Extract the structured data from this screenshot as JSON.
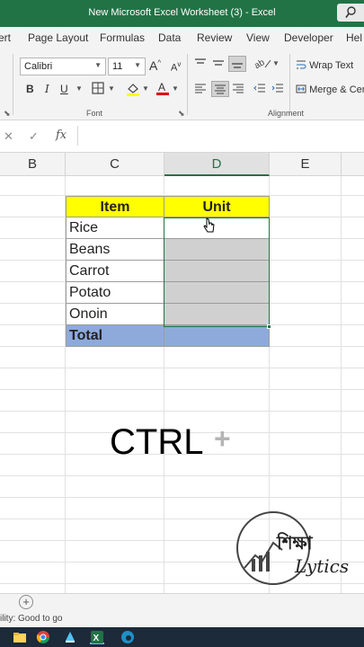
{
  "window": {
    "title": "New Microsoft Excel Worksheet (3)  -  Excel"
  },
  "ribbon_tabs": [
    "ert",
    "Page Layout",
    "Formulas",
    "Data",
    "Review",
    "View",
    "Developer",
    "Hel"
  ],
  "font_group": {
    "font_name": "Calibri",
    "font_size": "11",
    "grow_font": "A",
    "shrink_font": "A",
    "bold": "B",
    "italic": "I",
    "underline": "U",
    "label": "Font"
  },
  "alignment_group": {
    "wrap_text": "Wrap Text",
    "merge_center": "Merge & Cente",
    "label": "Alignment"
  },
  "formula_bar": {
    "cancel": "✕",
    "enter": "✓",
    "fx": "fx",
    "value": ""
  },
  "columns": [
    "B",
    "C",
    "D",
    "E"
  ],
  "table": {
    "headers": [
      "Item",
      "Unit"
    ],
    "rows": [
      {
        "item": "Rice",
        "unit": ""
      },
      {
        "item": "Beans",
        "unit": ""
      },
      {
        "item": "Carrot",
        "unit": ""
      },
      {
        "item": "Potato",
        "unit": ""
      },
      {
        "item": "Onoin",
        "unit": ""
      }
    ],
    "total_label": "Total"
  },
  "overlay": {
    "ctrl": "CTRL",
    "plus": "+"
  },
  "logo": {
    "text_bengali": "শিক্ষা",
    "text_latin": "Lytics"
  },
  "status": {
    "text": "ility: Good to go"
  },
  "colors": {
    "excel_green": "#217346",
    "header_fill": "#ffff00",
    "total_fill": "#8eaadb",
    "selected_fill": "#d0d0d0"
  }
}
